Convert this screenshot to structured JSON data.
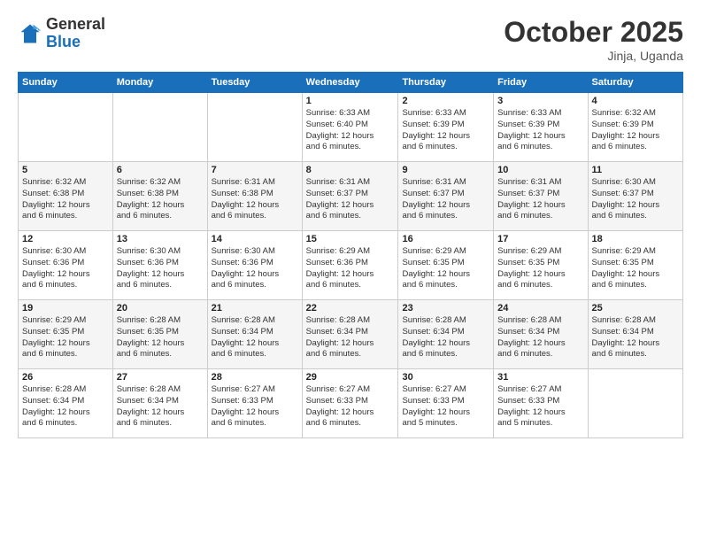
{
  "header": {
    "logo_general": "General",
    "logo_blue": "Blue",
    "month_title": "October 2025",
    "location": "Jinja, Uganda"
  },
  "weekdays": [
    "Sunday",
    "Monday",
    "Tuesday",
    "Wednesday",
    "Thursday",
    "Friday",
    "Saturday"
  ],
  "weeks": [
    [
      {
        "day": "",
        "info": ""
      },
      {
        "day": "",
        "info": ""
      },
      {
        "day": "",
        "info": ""
      },
      {
        "day": "1",
        "info": "Sunrise: 6:33 AM\nSunset: 6:40 PM\nDaylight: 12 hours\nand 6 minutes."
      },
      {
        "day": "2",
        "info": "Sunrise: 6:33 AM\nSunset: 6:39 PM\nDaylight: 12 hours\nand 6 minutes."
      },
      {
        "day": "3",
        "info": "Sunrise: 6:33 AM\nSunset: 6:39 PM\nDaylight: 12 hours\nand 6 minutes."
      },
      {
        "day": "4",
        "info": "Sunrise: 6:32 AM\nSunset: 6:39 PM\nDaylight: 12 hours\nand 6 minutes."
      }
    ],
    [
      {
        "day": "5",
        "info": "Sunrise: 6:32 AM\nSunset: 6:38 PM\nDaylight: 12 hours\nand 6 minutes."
      },
      {
        "day": "6",
        "info": "Sunrise: 6:32 AM\nSunset: 6:38 PM\nDaylight: 12 hours\nand 6 minutes."
      },
      {
        "day": "7",
        "info": "Sunrise: 6:31 AM\nSunset: 6:38 PM\nDaylight: 12 hours\nand 6 minutes."
      },
      {
        "day": "8",
        "info": "Sunrise: 6:31 AM\nSunset: 6:37 PM\nDaylight: 12 hours\nand 6 minutes."
      },
      {
        "day": "9",
        "info": "Sunrise: 6:31 AM\nSunset: 6:37 PM\nDaylight: 12 hours\nand 6 minutes."
      },
      {
        "day": "10",
        "info": "Sunrise: 6:31 AM\nSunset: 6:37 PM\nDaylight: 12 hours\nand 6 minutes."
      },
      {
        "day": "11",
        "info": "Sunrise: 6:30 AM\nSunset: 6:37 PM\nDaylight: 12 hours\nand 6 minutes."
      }
    ],
    [
      {
        "day": "12",
        "info": "Sunrise: 6:30 AM\nSunset: 6:36 PM\nDaylight: 12 hours\nand 6 minutes."
      },
      {
        "day": "13",
        "info": "Sunrise: 6:30 AM\nSunset: 6:36 PM\nDaylight: 12 hours\nand 6 minutes."
      },
      {
        "day": "14",
        "info": "Sunrise: 6:30 AM\nSunset: 6:36 PM\nDaylight: 12 hours\nand 6 minutes."
      },
      {
        "day": "15",
        "info": "Sunrise: 6:29 AM\nSunset: 6:36 PM\nDaylight: 12 hours\nand 6 minutes."
      },
      {
        "day": "16",
        "info": "Sunrise: 6:29 AM\nSunset: 6:35 PM\nDaylight: 12 hours\nand 6 minutes."
      },
      {
        "day": "17",
        "info": "Sunrise: 6:29 AM\nSunset: 6:35 PM\nDaylight: 12 hours\nand 6 minutes."
      },
      {
        "day": "18",
        "info": "Sunrise: 6:29 AM\nSunset: 6:35 PM\nDaylight: 12 hours\nand 6 minutes."
      }
    ],
    [
      {
        "day": "19",
        "info": "Sunrise: 6:29 AM\nSunset: 6:35 PM\nDaylight: 12 hours\nand 6 minutes."
      },
      {
        "day": "20",
        "info": "Sunrise: 6:28 AM\nSunset: 6:35 PM\nDaylight: 12 hours\nand 6 minutes."
      },
      {
        "day": "21",
        "info": "Sunrise: 6:28 AM\nSunset: 6:34 PM\nDaylight: 12 hours\nand 6 minutes."
      },
      {
        "day": "22",
        "info": "Sunrise: 6:28 AM\nSunset: 6:34 PM\nDaylight: 12 hours\nand 6 minutes."
      },
      {
        "day": "23",
        "info": "Sunrise: 6:28 AM\nSunset: 6:34 PM\nDaylight: 12 hours\nand 6 minutes."
      },
      {
        "day": "24",
        "info": "Sunrise: 6:28 AM\nSunset: 6:34 PM\nDaylight: 12 hours\nand 6 minutes."
      },
      {
        "day": "25",
        "info": "Sunrise: 6:28 AM\nSunset: 6:34 PM\nDaylight: 12 hours\nand 6 minutes."
      }
    ],
    [
      {
        "day": "26",
        "info": "Sunrise: 6:28 AM\nSunset: 6:34 PM\nDaylight: 12 hours\nand 6 minutes."
      },
      {
        "day": "27",
        "info": "Sunrise: 6:28 AM\nSunset: 6:34 PM\nDaylight: 12 hours\nand 6 minutes."
      },
      {
        "day": "28",
        "info": "Sunrise: 6:27 AM\nSunset: 6:33 PM\nDaylight: 12 hours\nand 6 minutes."
      },
      {
        "day": "29",
        "info": "Sunrise: 6:27 AM\nSunset: 6:33 PM\nDaylight: 12 hours\nand 6 minutes."
      },
      {
        "day": "30",
        "info": "Sunrise: 6:27 AM\nSunset: 6:33 PM\nDaylight: 12 hours\nand 5 minutes."
      },
      {
        "day": "31",
        "info": "Sunrise: 6:27 AM\nSunset: 6:33 PM\nDaylight: 12 hours\nand 5 minutes."
      },
      {
        "day": "",
        "info": ""
      }
    ]
  ]
}
